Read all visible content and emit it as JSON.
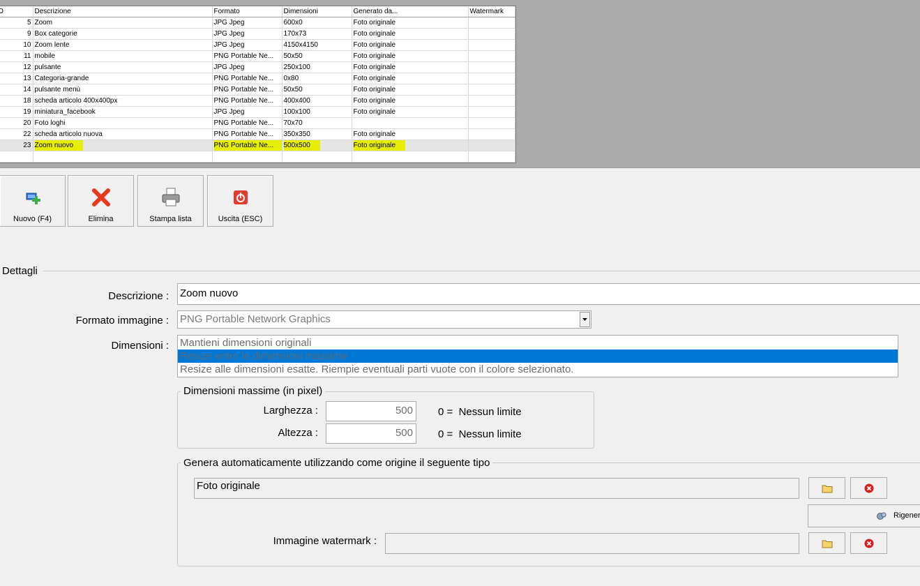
{
  "grid": {
    "columns": [
      "ID",
      "Descrizione",
      "Formato",
      "Dimensioni",
      "Generato da...",
      "Watermark"
    ],
    "rows": [
      {
        "id": "5",
        "descrizione": "Zoom",
        "formato": "JPG Jpeg",
        "dimensioni": "600x0",
        "generato": "Foto originale",
        "watermark": ""
      },
      {
        "id": "9",
        "descrizione": "Box categorie",
        "formato": "JPG Jpeg",
        "dimensioni": "170x73",
        "generato": "Foto originale",
        "watermark": ""
      },
      {
        "id": "10",
        "descrizione": "Zoom lente",
        "formato": "JPG Jpeg",
        "dimensioni": "4150x4150",
        "generato": "Foto originale",
        "watermark": ""
      },
      {
        "id": "11",
        "descrizione": "mobile",
        "formato": "PNG Portable Ne...",
        "dimensioni": "50x50",
        "generato": "Foto originale",
        "watermark": ""
      },
      {
        "id": "12",
        "descrizione": "pulsante",
        "formato": "JPG Jpeg",
        "dimensioni": "250x100",
        "generato": "Foto originale",
        "watermark": ""
      },
      {
        "id": "13",
        "descrizione": "Categoria-grande",
        "formato": "PNG Portable Ne...",
        "dimensioni": "0x80",
        "generato": "Foto originale",
        "watermark": ""
      },
      {
        "id": "14",
        "descrizione": "pulsante menù",
        "formato": "PNG Portable Ne...",
        "dimensioni": "50x50",
        "generato": "Foto originale",
        "watermark": ""
      },
      {
        "id": "18",
        "descrizione": "scheda articolo 400x400px",
        "formato": "PNG Portable Ne...",
        "dimensioni": "400x400",
        "generato": "Foto originale",
        "watermark": ""
      },
      {
        "id": "19",
        "descrizione": "miniatura_facebook",
        "formato": "JPG Jpeg",
        "dimensioni": "100x100",
        "generato": "Foto originale",
        "watermark": ""
      },
      {
        "id": "20",
        "descrizione": "Foto loghi",
        "formato": "PNG Portable Ne...",
        "dimensioni": "70x70",
        "generato": "",
        "watermark": ""
      },
      {
        "id": "22",
        "descrizione": "scheda articolo nuova",
        "formato": "PNG Portable Ne...",
        "dimensioni": "350x350",
        "generato": "Foto originale",
        "watermark": ""
      },
      {
        "id": "23",
        "descrizione": "Zoom nuovo",
        "formato": "PNG Portable Ne...",
        "dimensioni": "500x500",
        "generato": "Foto originale",
        "watermark": "",
        "selected": true
      }
    ]
  },
  "toolbar": {
    "new_label": "Nuovo (F4)",
    "delete_label": "Elimina",
    "print_label": "Stampa lista",
    "exit_label": "Uscita (ESC)"
  },
  "details": {
    "section_title": "Dettagli",
    "descrizione_label": "Descrizione :",
    "descrizione_value": "Zoom nuovo",
    "formato_label": "Formato immagine :",
    "formato_value": "PNG Portable Network Graphics",
    "dimensioni_label": "Dimensioni :",
    "dimensioni_options": [
      "Mantieni dimensioni originali",
      "Resize entro le dimensioni massime",
      "Resize alle dimensioni esatte. Riempie eventuali parti vuote con il colore selezionato."
    ],
    "dimensioni_selected_index": 1,
    "max_group_title": "Dimensioni massime (in pixel)",
    "larghezza_label": "Larghezza :",
    "larghezza_value": "500",
    "larghezza_hint": "0 =  Nessun limite",
    "altezza_label": "Altezza :",
    "altezza_value": "500",
    "altezza_hint": "0 =  Nessun limite",
    "origin_group_title": "Genera automaticamente utilizzando come origine il seguente tipo",
    "origin_value": "Foto originale",
    "regen_label": "Rigener",
    "watermark_label": "Immagine watermark :",
    "watermark_value": ""
  },
  "colors": {
    "highlight": "#e8ee00",
    "selection": "#0078d7",
    "grid_bg": "#ababab"
  }
}
